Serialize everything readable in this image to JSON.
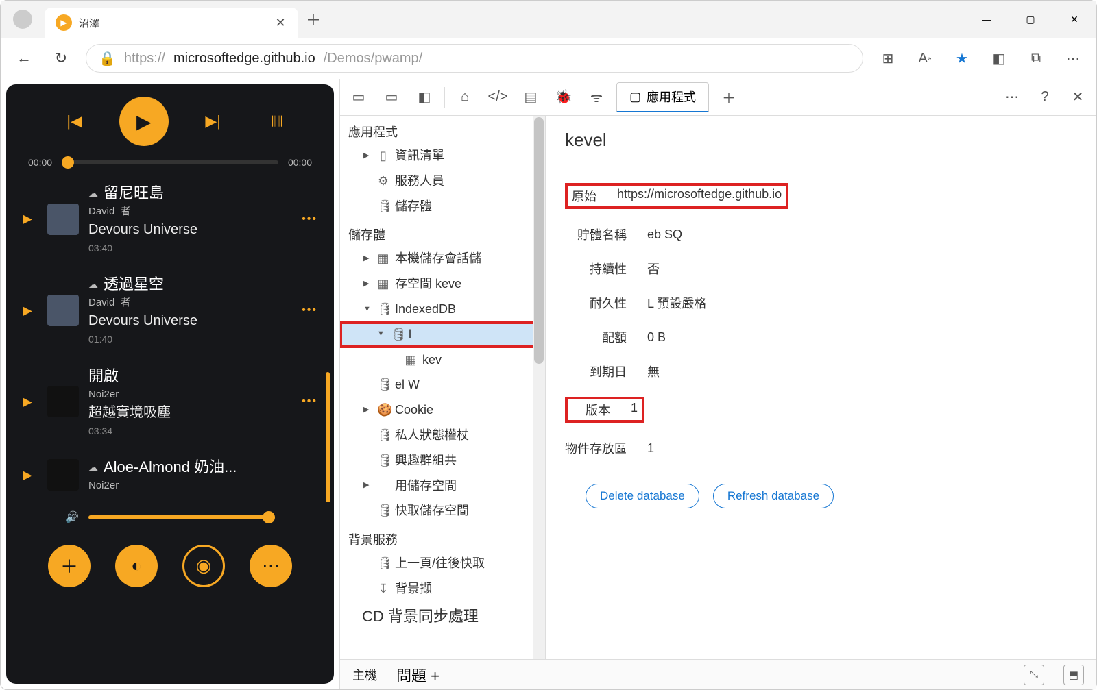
{
  "window": {
    "tab_title": "沼澤",
    "url_prefix": "https://",
    "url_host": "microsoftedge.github.io",
    "url_path": "/Demos/pwamp/"
  },
  "player": {
    "time_start": "00:00",
    "time_end": "00:00",
    "tracks": [
      {
        "line1": "留尼旺島",
        "artist": "David",
        "suffix": "者",
        "sub": "Devours Universe",
        "dur": "03:40",
        "cloud": true
      },
      {
        "line1": "透過星空",
        "artist": "David",
        "suffix": "者",
        "sub": "Devours Universe",
        "dur": "01:40",
        "cloud": true
      },
      {
        "line1": "開啟",
        "artist": "Noi2er",
        "suffix": "",
        "sub": "超越實境吸塵",
        "dur": "03:34",
        "cloud": false
      },
      {
        "line1": "Aloe-Almond 奶油...",
        "artist": "Noi2er",
        "suffix": "",
        "sub": "",
        "dur": "",
        "cloud": true
      }
    ]
  },
  "devtools": {
    "active_tab": "應用程式",
    "tree": {
      "app_section": "應用程式",
      "manifest": "資訊清單",
      "service_workers": "服務人員",
      "storage_node": "儲存體",
      "storage_section": "儲存體",
      "local_storage": "本機儲存會話儲",
      "storage_keve": "存空間 keve",
      "indexeddb": "IndexedDB",
      "db_l": "l",
      "db_kev": "kev",
      "el_w": "el W",
      "cookie": "Cookie",
      "private_state": "私人狀態權杖",
      "interest_groups": "興趣群組共",
      "usage_storage": "用儲存空間",
      "cache_storage": "快取儲存空間",
      "background_section": "背景服務",
      "bfcache": "上一頁/往後快取",
      "background_fetch": "背景擷",
      "background_sync": "CD 背景同步處理"
    },
    "detail": {
      "title": "kevel",
      "origin_label": "原始",
      "origin": "https://microsoftedge.github.io",
      "bucket_label": "貯體名稱",
      "bucket": "eb SQ",
      "persistent_label": "持續性",
      "persistent": "否",
      "durability_label": "耐久性",
      "durability": "L 預設嚴格",
      "quota_label": "配額",
      "quota": "0 B",
      "expiration_label": "到期日",
      "expiration": "無",
      "version_label": "版本",
      "version": "1",
      "stores_label": "物件存放區",
      "stores": "1",
      "delete_btn": "Delete database",
      "refresh_btn": "Refresh database"
    },
    "footer": {
      "main": "主機",
      "issues": "問題 +"
    }
  }
}
